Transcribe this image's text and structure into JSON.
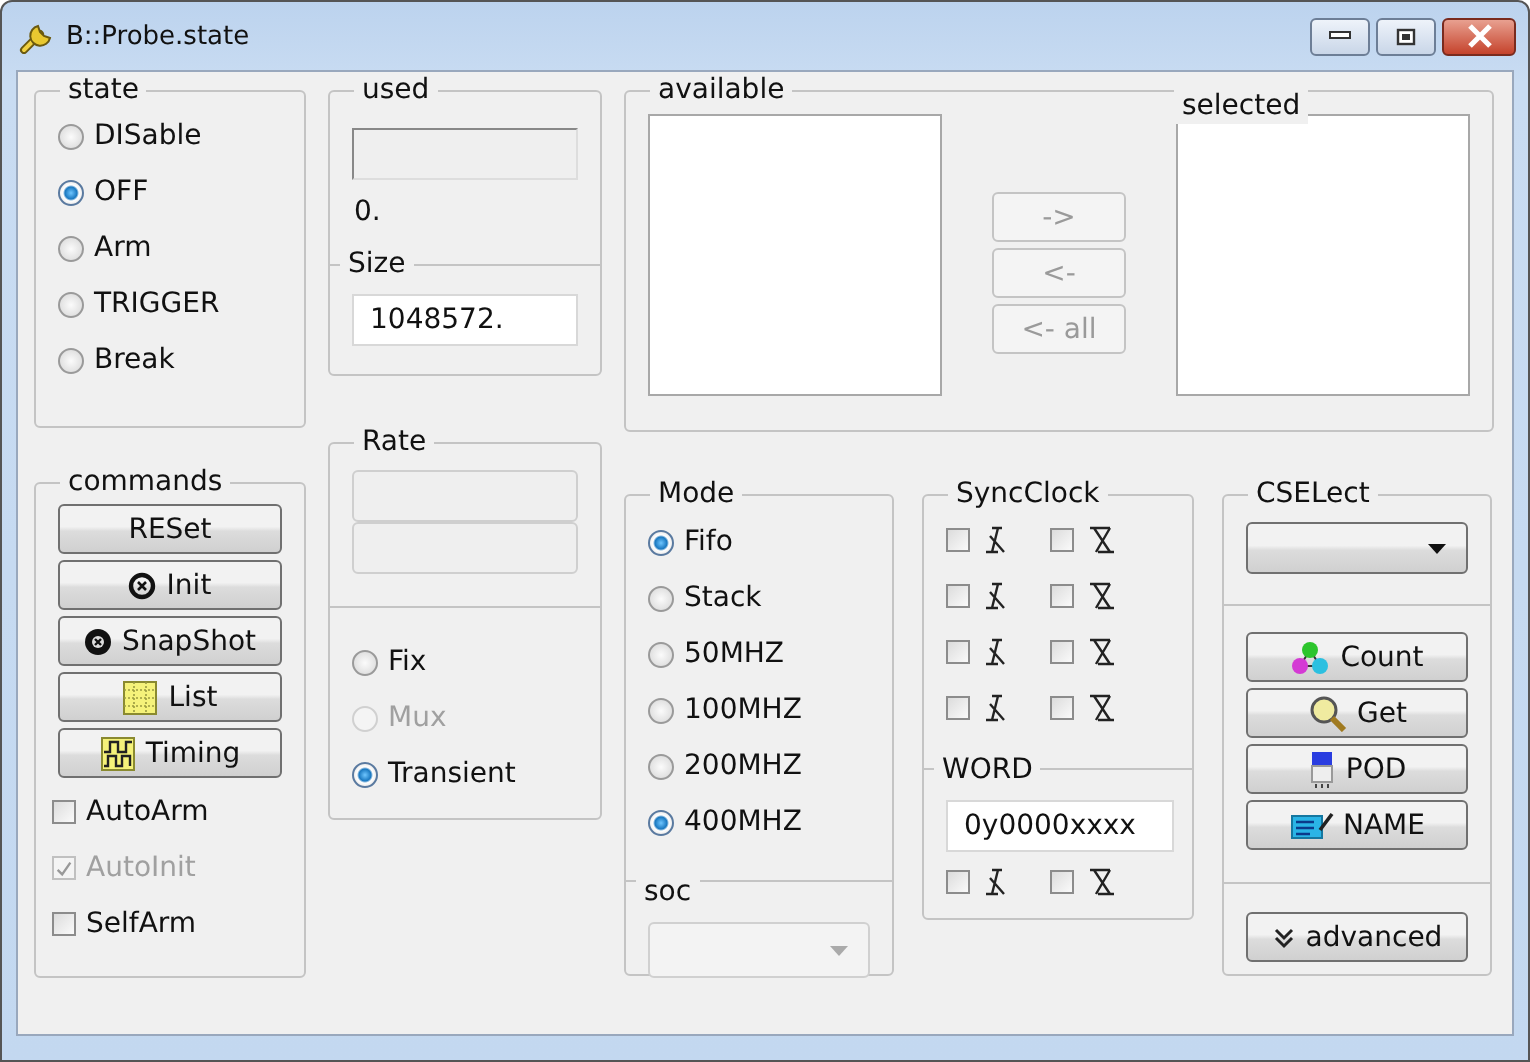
{
  "window": {
    "title": "B::Probe.state"
  },
  "state": {
    "label": "state",
    "options": [
      {
        "label": "DISable",
        "selected": false
      },
      {
        "label": "OFF",
        "selected": true
      },
      {
        "label": "Arm",
        "selected": false
      },
      {
        "label": "TRIGGER",
        "selected": false
      },
      {
        "label": "Break",
        "selected": false
      }
    ]
  },
  "used": {
    "label": "used",
    "value": "0.",
    "size_label": "Size",
    "size_value": "1048572."
  },
  "transfer": {
    "available_label": "available",
    "selected_label": "selected",
    "buttons": [
      {
        "label": "->",
        "disabled": true
      },
      {
        "label": "<-",
        "disabled": true
      },
      {
        "label": "<- all",
        "disabled": true
      }
    ]
  },
  "commands": {
    "label": "commands",
    "buttons": [
      {
        "label": "RESet",
        "kind": "plain"
      },
      {
        "label": "Init",
        "kind": "init"
      },
      {
        "label": "SnapShot",
        "kind": "snapshot"
      },
      {
        "label": "List",
        "kind": "list"
      },
      {
        "label": "Timing",
        "kind": "timing"
      }
    ],
    "checkboxes": [
      {
        "label": "AutoArm",
        "checked": false,
        "disabled": false
      },
      {
        "label": "AutoInit",
        "checked": true,
        "disabled": true
      },
      {
        "label": "SelfArm",
        "checked": false,
        "disabled": false
      }
    ]
  },
  "rate": {
    "label": "Rate",
    "options": [
      {
        "label": "Fix",
        "selected": false,
        "disabled": false
      },
      {
        "label": "Mux",
        "selected": false,
        "disabled": true
      },
      {
        "label": "Transient",
        "selected": true,
        "disabled": false
      }
    ]
  },
  "mode": {
    "label": "Mode",
    "options": [
      {
        "label": "Fifo",
        "selected": true
      },
      {
        "label": "Stack",
        "selected": false
      },
      {
        "label": "50MHZ",
        "selected": false
      },
      {
        "label": "100MHZ",
        "selected": false
      },
      {
        "label": "200MHZ",
        "selected": false
      },
      {
        "label": "400MHZ",
        "selected": true
      }
    ],
    "soc": {
      "label": "soc",
      "disabled": true
    }
  },
  "syncclock": {
    "label": "SyncClock",
    "rows": [
      [
        {
          "checked": false
        },
        {
          "checked": false
        }
      ],
      [
        {
          "checked": false
        },
        {
          "checked": false
        }
      ],
      [
        {
          "checked": false
        },
        {
          "checked": false
        }
      ],
      [
        {
          "checked": false
        },
        {
          "checked": false
        }
      ]
    ],
    "word_label": "WORD",
    "word_value": "0y0000xxxx",
    "word_row": [
      {
        "checked": false
      },
      {
        "checked": false
      }
    ]
  },
  "cselect": {
    "label": "CSELect",
    "buttons": [
      {
        "label": "Count",
        "kind": "count"
      },
      {
        "label": "Get",
        "kind": "get"
      },
      {
        "label": "POD",
        "kind": "pod"
      },
      {
        "label": "NAME",
        "kind": "name"
      }
    ],
    "advanced": "advanced"
  }
}
